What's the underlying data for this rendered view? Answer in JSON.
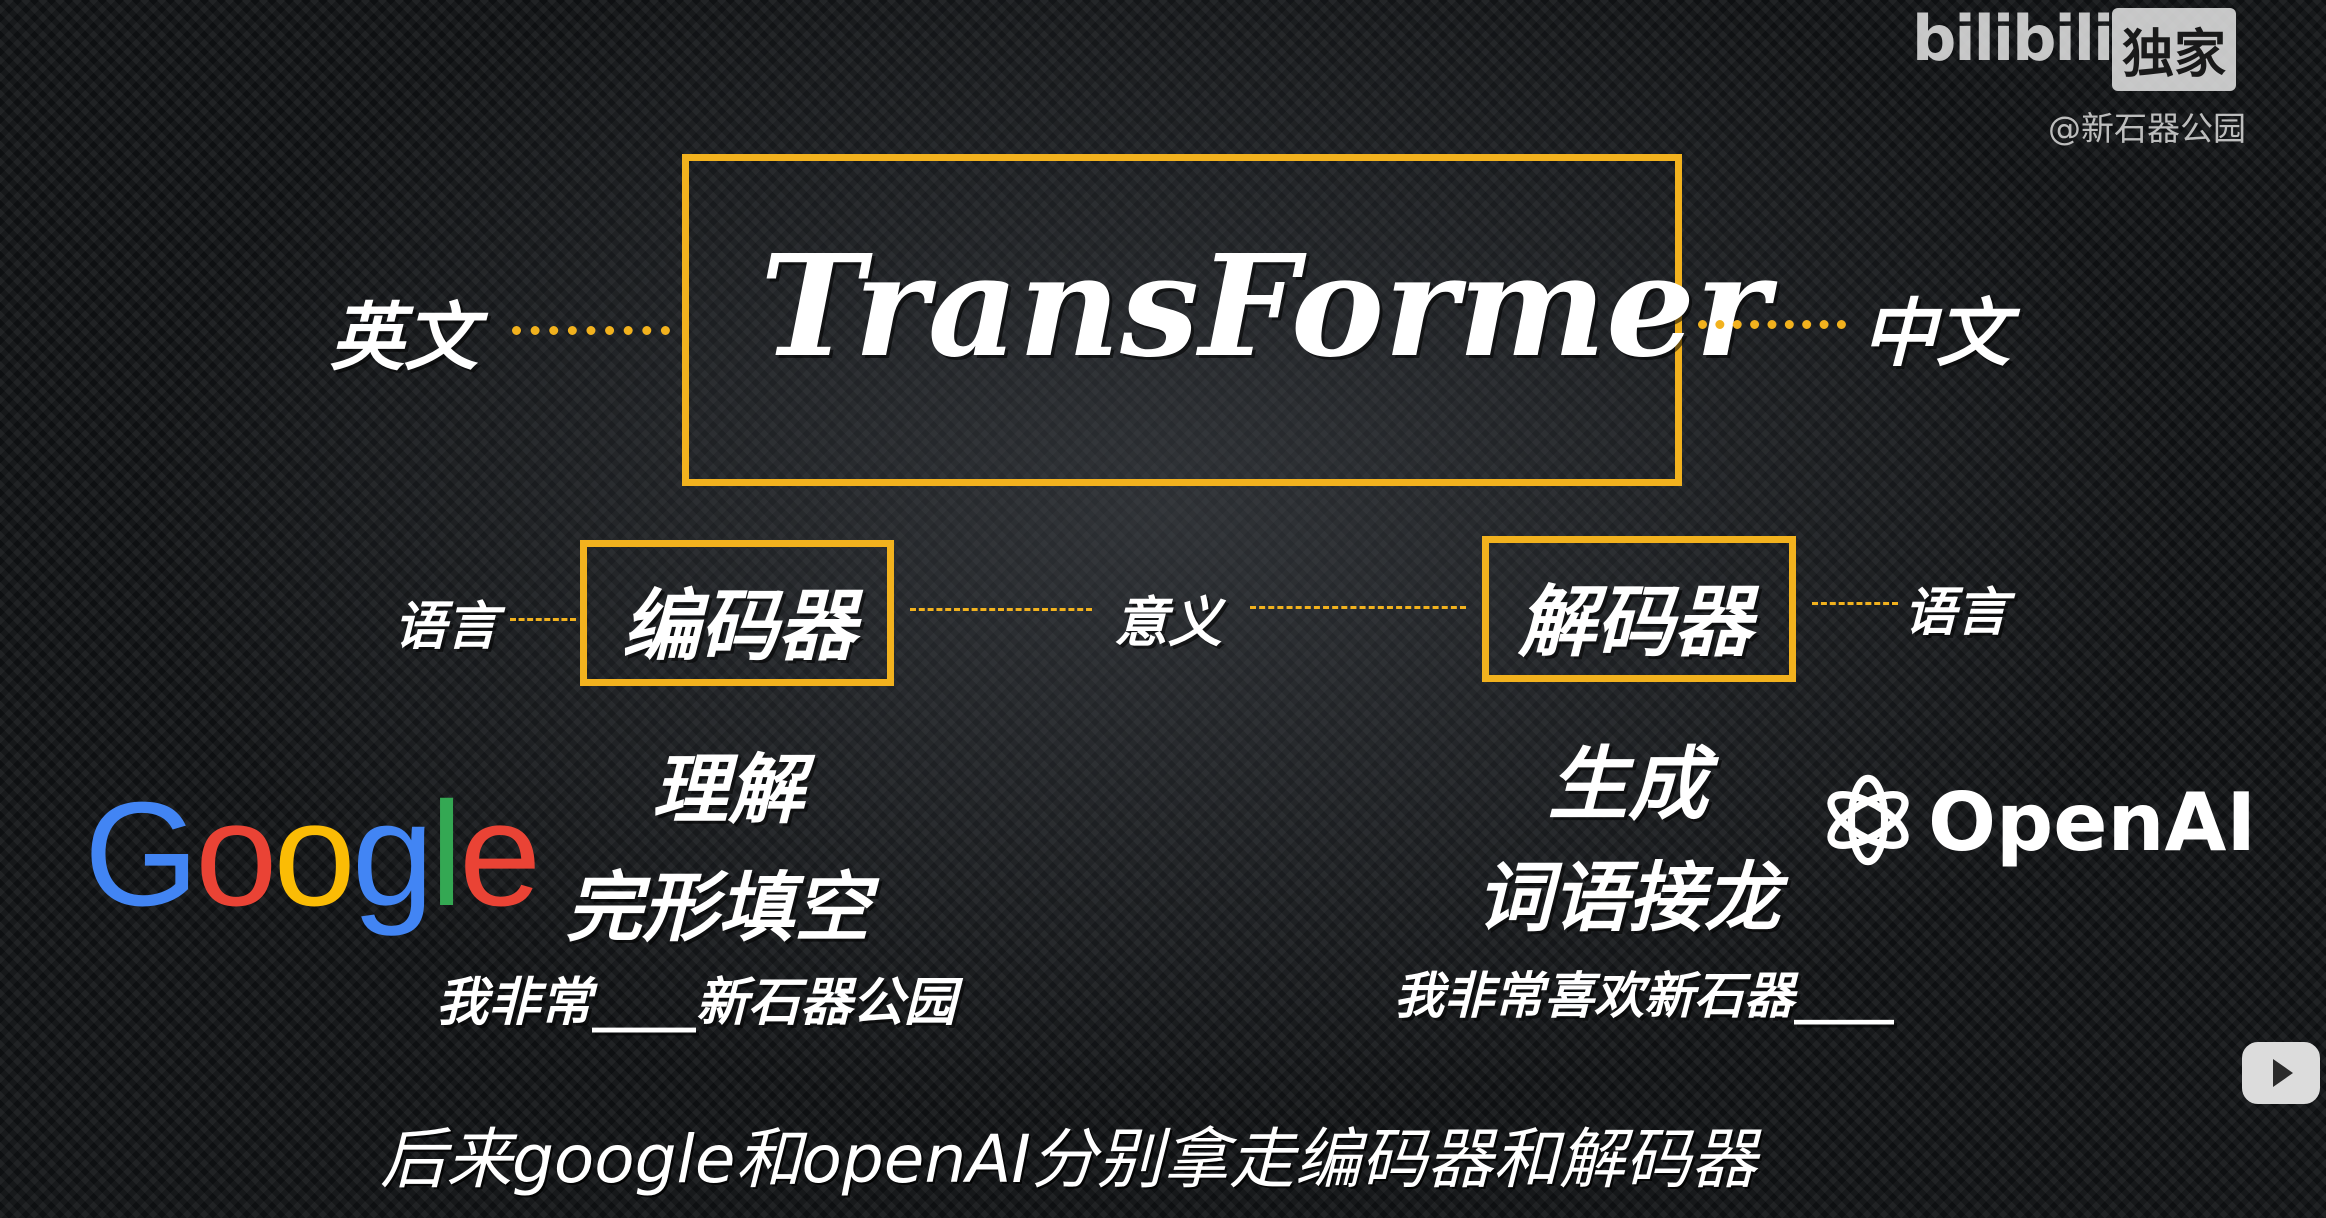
{
  "watermark": {
    "logo": "bilibili",
    "badge": "独家",
    "author": "@新石器公园"
  },
  "center": {
    "title": "TransFormer",
    "left_label": "英文",
    "right_label": "中文"
  },
  "encoder": {
    "label": "编码器",
    "input_label": "语言",
    "role": "理解",
    "task": "完形填空",
    "example": "我非常____新石器公园"
  },
  "middle": {
    "label": "意义"
  },
  "decoder": {
    "label": "解码器",
    "output_label": "语言",
    "role": "生成",
    "task": "词语接龙",
    "example": "我非常喜欢新石器____"
  },
  "logos": {
    "google_letters": [
      "G",
      "o",
      "o",
      "g",
      "l",
      "e"
    ],
    "google_colors": [
      "#4285F4",
      "#EA4335",
      "#FBBC05",
      "#4285F4",
      "#34A853",
      "#EA4335"
    ],
    "openai": "OpenAI"
  },
  "subtitle": "后来google和openAI分别拿走编码器和解码器",
  "colors": {
    "accent": "#F2B21E"
  }
}
